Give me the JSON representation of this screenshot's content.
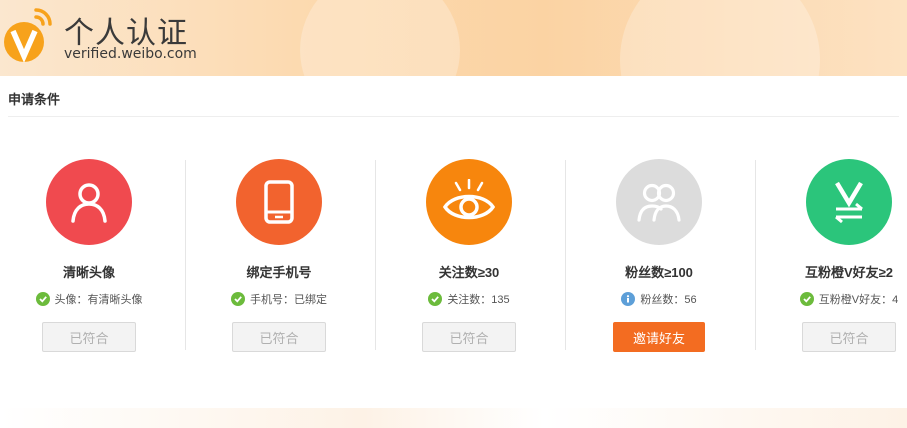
{
  "header": {
    "title": "个人认证",
    "subtitle": "verified.weibo.com",
    "logo_icon": "v-badge-icon",
    "colors": {
      "logo": "#f7a21b",
      "band": "#fcd9ae"
    }
  },
  "section": {
    "title": "申请条件"
  },
  "cards": [
    {
      "icon": "person-icon",
      "color": "#f04a4f",
      "title": "清晰头像",
      "status_icon": "check-icon",
      "status": "头像：有清晰头像",
      "button": "已符合",
      "button_state": "disabled"
    },
    {
      "icon": "phone-icon",
      "color": "#f2632e",
      "title": "绑定手机号",
      "status_icon": "check-icon",
      "status": "手机号：已绑定",
      "button": "已符合",
      "button_state": "disabled"
    },
    {
      "icon": "eye-icon",
      "color": "#f7860d",
      "title": "关注数≥30",
      "status_icon": "check-icon",
      "status": "关注数：135",
      "button": "已符合",
      "button_state": "disabled"
    },
    {
      "icon": "fans-icon",
      "color": "#dcdcdc",
      "title": "粉丝数≥100",
      "status_icon": "info-icon",
      "status": "粉丝数：56",
      "button": "邀请好友",
      "button_state": "active"
    },
    {
      "icon": "mutual-v-icon",
      "color": "#2bc57b",
      "title": "互粉橙V好友≥2",
      "status_icon": "check-icon",
      "status": "互粉橙V好友：4",
      "button": "已符合",
      "button_state": "disabled"
    }
  ],
  "status_colors": {
    "check": "#6cbb3c",
    "info": "#5d9fd8",
    "button_active": "#f36c21"
  }
}
